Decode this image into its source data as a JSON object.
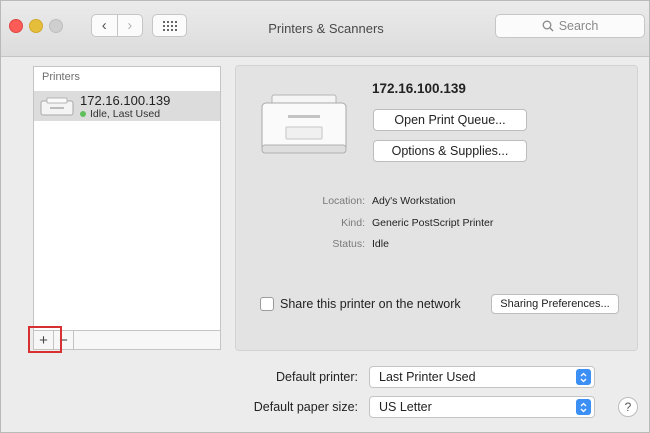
{
  "window": {
    "title": "Printers & Scanners",
    "search_placeholder": "Search"
  },
  "sidebar": {
    "header": "Printers",
    "printers": [
      {
        "name": "172.16.100.139",
        "status": "Idle, Last Used"
      }
    ],
    "add_label": "+",
    "remove_label": "−"
  },
  "details": {
    "name": "172.16.100.139",
    "open_queue_label": "Open Print Queue...",
    "options_label": "Options & Supplies...",
    "location_label": "Location:",
    "location_value": "Ady's Workstation",
    "kind_label": "Kind:",
    "kind_value": "Generic PostScript Printer",
    "status_label": "Status:",
    "status_value": "Idle",
    "share_label": "Share this printer on the network",
    "share_checked": false,
    "sharing_prefs_label": "Sharing Preferences..."
  },
  "defaults": {
    "printer_label": "Default printer:",
    "printer_value": "Last Printer Used",
    "paper_label": "Default paper size:",
    "paper_value": "US Letter"
  },
  "help_label": "?",
  "colors": {
    "accent": "#3b8ff5",
    "highlight": "#d63030",
    "status_green": "#5fc05b",
    "close": "#fc5b57",
    "minimize": "#e5bf3c"
  }
}
